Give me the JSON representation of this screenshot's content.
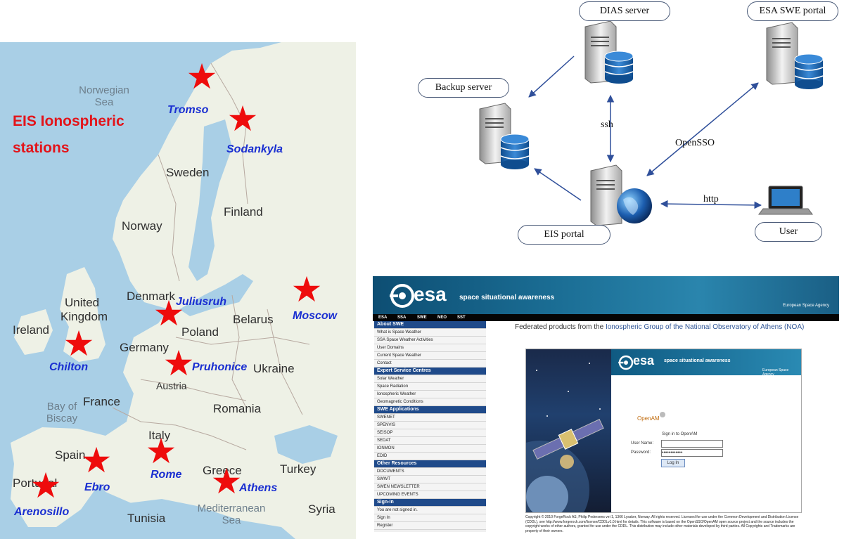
{
  "map": {
    "title_line1": "EIS Ionospheric",
    "title_line2": "stations",
    "countries": {
      "sweden": "Sweden",
      "finland": "Finland",
      "norway": "Norway",
      "uk_line1": "United",
      "uk_line2": "Kingdom",
      "ireland": "Ireland",
      "denmark": "Denmark",
      "poland": "Poland",
      "belarus": "Belarus",
      "germany": "Germany",
      "ukraine": "Ukraine",
      "austria": "Austria",
      "france": "France",
      "romania": "Romania",
      "italy": "Italy",
      "spain": "Spain",
      "portugal": "Portugal",
      "greece": "Greece",
      "turkey": "Turkey",
      "syria": "Syria",
      "tunisia": "Tunisia"
    },
    "seas": {
      "norwegian_1": "Norwegian",
      "norwegian_2": "Sea",
      "biscay_1": "Bay of",
      "biscay_2": "Biscay",
      "med_1": "Mediterranean",
      "med_2": "Sea"
    },
    "stations": [
      "Tromso",
      "Sodankyla",
      "Juliusruh",
      "Moscow",
      "Chilton",
      "Pruhonice",
      "Ebro",
      "Rome",
      "Athens",
      "Arenosillo"
    ],
    "star_glyph": "★",
    "star_color": "#ee0c0c",
    "city_color": "#1a2fd1"
  },
  "diagram": {
    "nodes": {
      "dias": "DIAS server",
      "esa_swe": "ESA SWE portal",
      "backup": "Backup server",
      "eis": "EIS portal",
      "user": "User"
    },
    "edges": {
      "ssh": "ssh",
      "opensso": "OpenSSO",
      "http": "http"
    }
  },
  "esa_portal": {
    "logo": "esa",
    "banner_subtitle": "space situational awareness",
    "agency": "European Space Agency",
    "nav": [
      "ESA",
      "SSA",
      "SWE",
      "NEO",
      "SST"
    ],
    "heading_prefix": "Federated products from the ",
    "heading_link": "Ionospheric Group of the National Observatory of Athens (NOA)",
    "sidebar": [
      {
        "title": "About SWE",
        "items": [
          "What is Space Weather",
          "SSA Space Weather Activities",
          "User Domains",
          "Current Space Weather",
          "Contact"
        ]
      },
      {
        "title": "Expert Service Centres",
        "items": [
          "Solar Weather",
          "Space Radiation",
          "Ionospheric Weather",
          "Geomagnetic Conditions"
        ]
      },
      {
        "title": "SWE Applications",
        "items": [
          "SWENET",
          "SPENVIS",
          "SEISOP",
          "SEDAT",
          "IONMON",
          "EDID"
        ]
      },
      {
        "title": "Other Resources",
        "items": [
          "DOCUMENTS",
          "SWWT",
          "SWEN NEWSLETTER",
          "UPCOMING EVENTS"
        ]
      },
      {
        "title": "Sign-In",
        "items": [
          "You are not signed in.",
          "Sign In",
          "Register"
        ]
      }
    ],
    "login": {
      "logo": "esa",
      "subtitle": "space situational awareness",
      "agency": "European Space Agency",
      "openam": "OpenAM",
      "sign_in_title": "Sign in to OpenAM",
      "username_label": "User Name:",
      "password_label": "Password:",
      "password_value": "••••••••••••",
      "button": "Log In"
    },
    "footer": "Copyright © 2010 ForgeRock AS, Philip Pedersens vei 1, 1366 Lysaker, Norway. All rights reserved. Licensed for use under the Common Development and Distribution License (CDDL), see http://www.forgerock.com/license/CDDLv1.0.html for details. This software is based on the OpenSSO/OpenAM open source project and the source includes the copyright works of other authors, granted for use under the CDDL. This distribution may include other materials developed by third parties. All Copyrights and Trademarks are property of their owners."
  }
}
